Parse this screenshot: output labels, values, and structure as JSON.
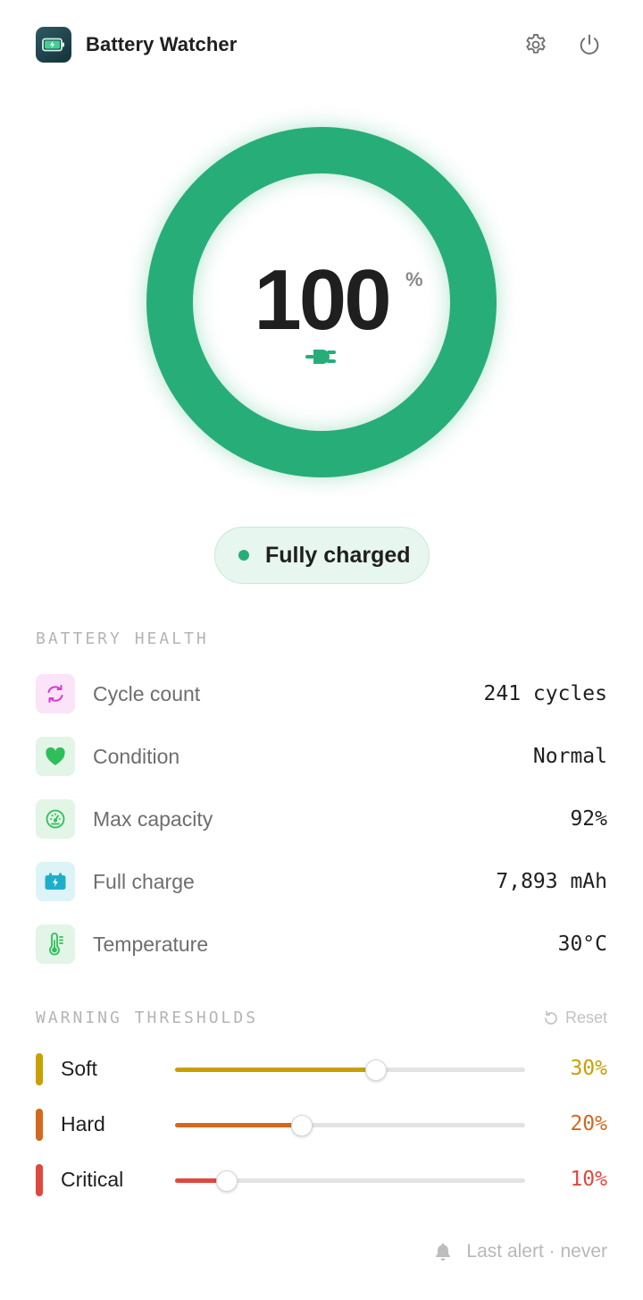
{
  "app": {
    "title": "Battery Watcher"
  },
  "gauge": {
    "percent": "100",
    "percent_sign": "%",
    "level": 1.0,
    "color": "#27ae78"
  },
  "status": {
    "text": "Fully charged",
    "dot_color": "#27ae78"
  },
  "health": {
    "section_title": "BATTERY HEALTH",
    "items": [
      {
        "icon": "cycle-icon",
        "label": "Cycle count",
        "value": "241 cycles"
      },
      {
        "icon": "heart-icon",
        "label": "Condition",
        "value": "Normal"
      },
      {
        "icon": "gauge-icon",
        "label": "Max capacity",
        "value": "92%"
      },
      {
        "icon": "battery-charge-icon",
        "label": "Full charge",
        "value": "7,893 mAh"
      },
      {
        "icon": "thermometer-icon",
        "label": "Temperature",
        "value": "30°C"
      }
    ]
  },
  "thresholds": {
    "section_title": "WARNING THRESHOLDS",
    "reset_label": "Reset",
    "items": [
      {
        "label": "Soft",
        "value": "30%",
        "level": 0.575,
        "color": "#c9a000"
      },
      {
        "label": "Hard",
        "value": "20%",
        "level": 0.363,
        "color": "#d2691e"
      },
      {
        "label": "Critical",
        "value": "10%",
        "level": 0.148,
        "color": "#e0483e"
      }
    ]
  },
  "footer": {
    "last_alert": "Last alert · never"
  }
}
